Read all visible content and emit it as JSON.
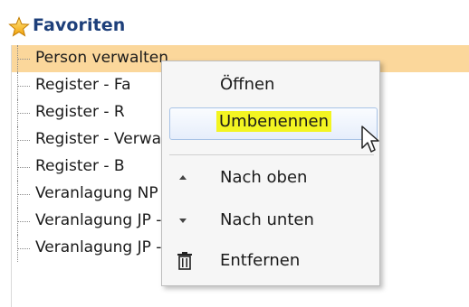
{
  "header": {
    "title": "Favoriten",
    "icon": "star-icon"
  },
  "tree": {
    "items": [
      {
        "label": "Person verwalten",
        "selected": true
      },
      {
        "label": "Register - Fa"
      },
      {
        "label": "Register - R"
      },
      {
        "label": "Register - Verwaltungsdokumente anzeigen"
      },
      {
        "label": "Register - B"
      },
      {
        "label": "Veranlagung NP - Dossiers anzeigen"
      },
      {
        "label": "Veranlagung JP - Dossierübersicht"
      },
      {
        "label": "Veranlagung JP - Dossierübersicht"
      }
    ]
  },
  "context_menu": {
    "items": [
      {
        "label": "Öffnen",
        "icon": ""
      },
      {
        "label": "Umbenennen",
        "icon": "",
        "hovered": true
      },
      {
        "label": "Nach oben",
        "icon": "arrow-up-icon"
      },
      {
        "label": "Nach unten",
        "icon": "arrow-down-icon"
      },
      {
        "label": "Entfernen",
        "icon": "trash-icon"
      }
    ]
  },
  "colors": {
    "selection": "#fbd79b",
    "highlight": "#f3f522",
    "header_text": "#1d3f7a"
  }
}
